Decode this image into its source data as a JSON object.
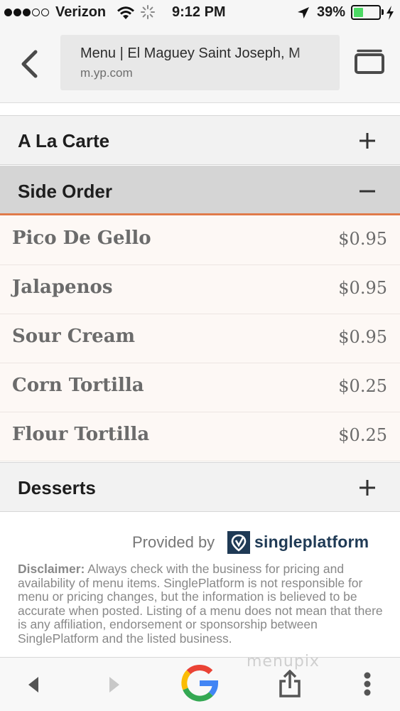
{
  "status_bar": {
    "carrier": "Verizon",
    "time": "9:12 PM",
    "battery_percent": "39%",
    "battery_level": 0.39,
    "signal_bars": 3,
    "signal_total": 5
  },
  "browser": {
    "page_title": "Menu | El Maguey Saint Joseph, M",
    "domain": "m.yp.com"
  },
  "menu": {
    "sections": [
      {
        "title": "A La Carte",
        "toggle": "+",
        "expanded": false
      },
      {
        "title": "Side Order",
        "toggle": "−",
        "expanded": true
      },
      {
        "title": "Desserts",
        "toggle": "+",
        "expanded": false
      }
    ],
    "side_order_items": [
      {
        "name": "Pico De Gello",
        "price": "$0.95"
      },
      {
        "name": "Jalapenos",
        "price": "$0.95"
      },
      {
        "name": "Sour Cream",
        "price": "$0.95"
      },
      {
        "name": "Corn Tortilla",
        "price": "$0.25"
      },
      {
        "name": "Flour Tortilla",
        "price": "$0.25"
      }
    ]
  },
  "footer": {
    "provided_by": "Provided by",
    "brand": "singleplatform",
    "disclaimer_label": "Disclaimer:",
    "disclaimer_text": " Always check with the business for pricing and availability of menu items. SinglePlatform is not responsible for menu or pricing changes, but the information is believed to be accurate when posted. Listing of a menu does not mean that there is any affiliation, endorsement or sponsorship between SinglePlatform and the listed business."
  },
  "watermark": "menupix",
  "colors": {
    "accent_orange": "#e07a4a",
    "brand_navy": "#1f3a55",
    "battery_green": "#4cd964"
  },
  "icons": [
    "back-chevron-icon",
    "tabs-icon",
    "wifi-icon",
    "location-arrow-icon",
    "charging-bolt-icon",
    "google-icon",
    "share-icon",
    "more-icon"
  ]
}
